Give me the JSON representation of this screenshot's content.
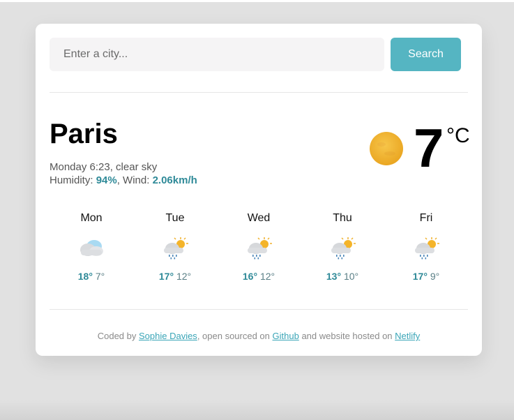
{
  "search": {
    "placeholder": "Enter a city...",
    "value": "",
    "button_label": "Search"
  },
  "current": {
    "city": "Paris",
    "datetime_desc": "Monday 6:23, clear sky",
    "humidity_label": "Humidity: ",
    "humidity_value": "94%",
    "wind_label": ", Wind: ",
    "wind_value": "2.06km/h",
    "icon": "clear-sky-sun-icon",
    "temperature": "7",
    "unit": "°C"
  },
  "forecast": [
    {
      "day": "Mon",
      "icon": "cloudy-icon",
      "max": "18°",
      "min": "7°"
    },
    {
      "day": "Tue",
      "icon": "sun-cloud-rain-icon",
      "max": "17°",
      "min": "12°"
    },
    {
      "day": "Wed",
      "icon": "sun-cloud-rain-icon",
      "max": "16°",
      "min": "12°"
    },
    {
      "day": "Thu",
      "icon": "sun-cloud-rain-icon",
      "max": "13°",
      "min": "10°"
    },
    {
      "day": "Fri",
      "icon": "sun-cloud-rain-icon",
      "max": "17°",
      "min": "9°"
    }
  ],
  "footer": {
    "prefix": "Coded by ",
    "author": "Sophie Davies",
    "mid": ", open sourced on ",
    "github": "Github",
    "mid2": " and website hosted on ",
    "host": "Netlify"
  },
  "colors": {
    "accent": "#55b5c2",
    "highlight": "#2f8a98",
    "sun": "#f4b42a"
  }
}
